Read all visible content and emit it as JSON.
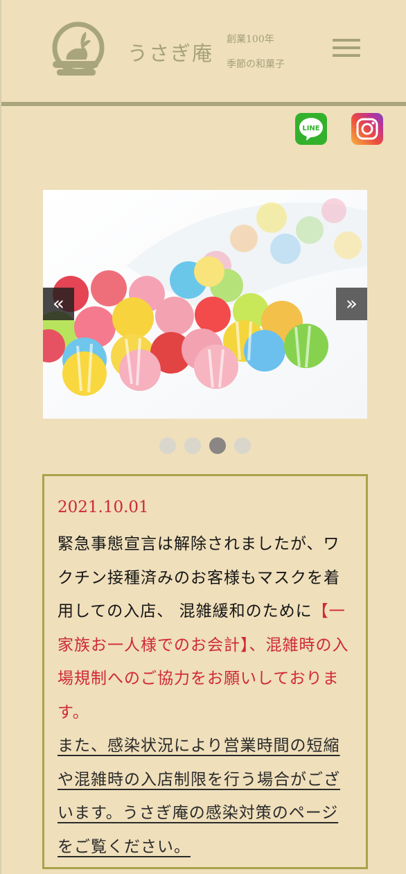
{
  "header": {
    "brand_name": "うさぎ庵",
    "tagline_1": "創業100年",
    "tagline_2": "季節の和菓子",
    "menu_icon": "hamburger-menu-icon"
  },
  "social": {
    "line_label": "LINE",
    "line_icon": "line-icon",
    "instagram_icon": "instagram-icon"
  },
  "slider": {
    "prev_label": "«",
    "next_label": "»",
    "dots": [
      false,
      false,
      true,
      false
    ],
    "image": "colorful-candies-photo"
  },
  "notice": {
    "date": "2021.10.01",
    "text_black": "緊急事態宣言は解除されましたが、ワクチン接種済みのお客様もマスクを着用しての入店、 混雑緩和のために",
    "text_red": "【一家族お一人様でのお会計】、混雑時の入場規制へのご協力をお願いしております。",
    "link_text": "また、感染状況により営業時間の短縮や混雑時の入店制限を行う場合がございます。うさぎ庵の感染対策のページをご覧ください。"
  },
  "colors": {
    "background": "#efdfbb",
    "accent": "#a5a27a",
    "red": "#cf2836",
    "border": "#a8a34a"
  }
}
